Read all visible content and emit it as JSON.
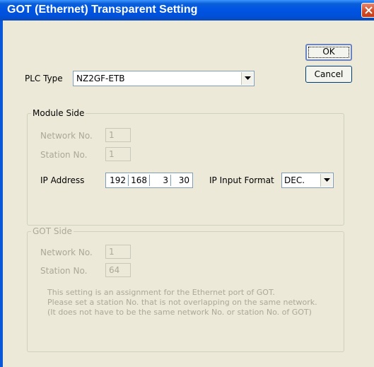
{
  "window": {
    "title": "GOT (Ethernet) Transparent Setting"
  },
  "buttons": {
    "ok": "OK",
    "cancel": "Cancel"
  },
  "plc_type": {
    "label": "PLC Type",
    "value": "NZ2GF-ETB"
  },
  "module_side": {
    "title": "Module Side",
    "network_no_label": "Network No.",
    "network_no": "1",
    "station_no_label": "Station No.",
    "station_no": "1",
    "ip_label": "IP Address",
    "ip": [
      "192",
      "168",
      "3",
      "30"
    ],
    "ip_format_label": "IP Input Format",
    "ip_format": "DEC."
  },
  "got_side": {
    "title": "GOT Side",
    "network_no_label": "Network No.",
    "network_no": "1",
    "station_no_label": "Station No.",
    "station_no": "64",
    "note_lines": [
      "This setting is an assignment for the Ethernet port of GOT.",
      "Please set a station No. that is not overlapping on the same network.",
      "(It does not have to be the same network No. or station No. of GOT)"
    ]
  }
}
